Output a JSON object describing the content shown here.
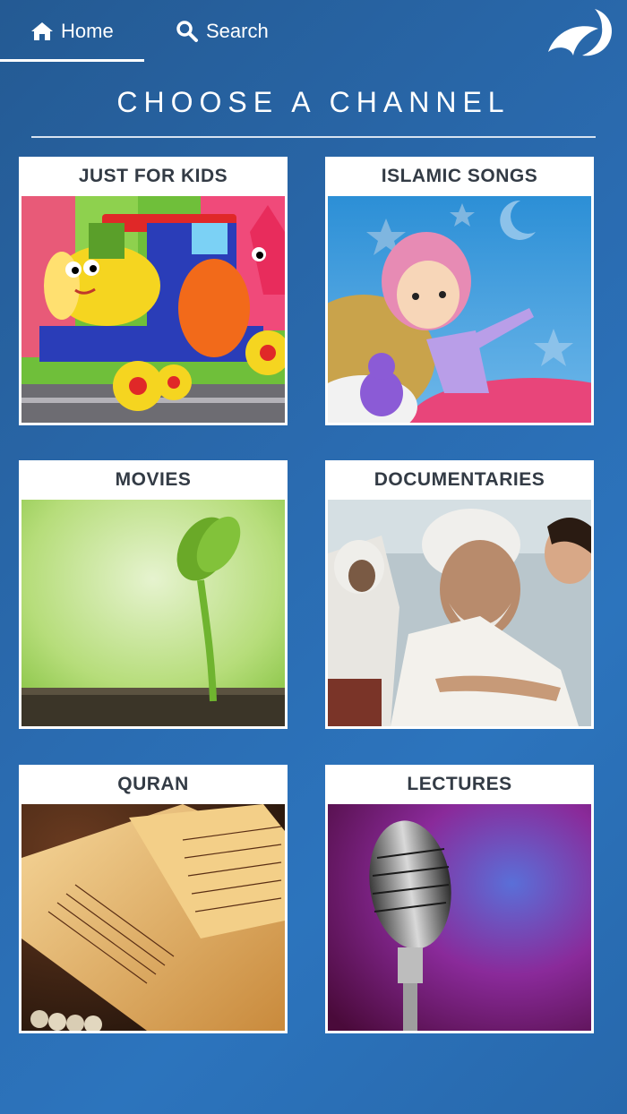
{
  "nav": {
    "home_label": "Home",
    "search_label": "Search",
    "active_tab": "Home"
  },
  "page": {
    "title": "CHOOSE A CHANNEL"
  },
  "channels": [
    {
      "label": "JUST FOR KIDS",
      "image": "cartoon-train"
    },
    {
      "label": "ISLAMIC SONGS",
      "image": "cartoon-girl-night"
    },
    {
      "label": "MOVIES",
      "image": "sprouting-seedling"
    },
    {
      "label": "DOCUMENTARIES",
      "image": "elderly-man-with-child"
    },
    {
      "label": "QURAN",
      "image": "open-quran-book"
    },
    {
      "label": "LECTURES",
      "image": "microphone"
    }
  ],
  "colors": {
    "background": "#2a6bb0",
    "card": "#ffffff",
    "card_title": "#333b45"
  }
}
